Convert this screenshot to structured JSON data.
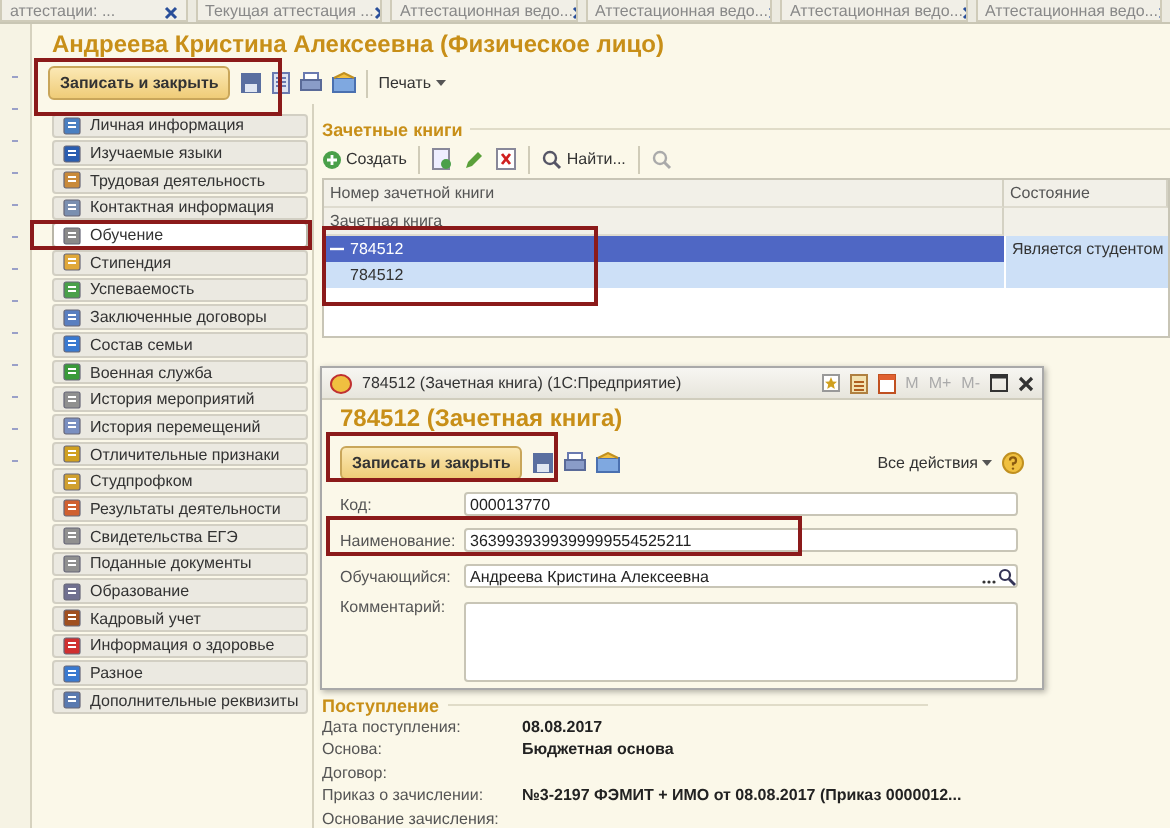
{
  "tabs": [
    {
      "label": "аттестации: ...",
      "selected": false
    },
    {
      "label": "Текущая аттестация ...",
      "selected": false
    },
    {
      "label": "Аттестационная ведо...",
      "selected": false
    },
    {
      "label": "Аттестационная ведо...",
      "selected": false
    },
    {
      "label": "Аттестационная ведо...",
      "selected": false
    },
    {
      "label": "Аттестационная ведо...",
      "selected": false
    }
  ],
  "form": {
    "title": "Андреева Кристина Алексеевна (Физическое лицо)",
    "save_button": "Записать и закрыть",
    "print_button": "Печать"
  },
  "sidebar": {
    "items": [
      {
        "label": "Личная информация",
        "selected": false
      },
      {
        "label": "Изучаемые языки",
        "selected": false
      },
      {
        "label": "Трудовая деятельность",
        "selected": false
      },
      {
        "label": "Контактная информация",
        "selected": false
      },
      {
        "label": "Обучение",
        "selected": true
      },
      {
        "label": "Стипендия",
        "selected": false
      },
      {
        "label": "Успеваемость",
        "selected": false
      },
      {
        "label": "Заключенные договоры",
        "selected": false
      },
      {
        "label": "Состав семьи",
        "selected": false
      },
      {
        "label": "Военная служба",
        "selected": false
      },
      {
        "label": "История мероприятий",
        "selected": false
      },
      {
        "label": "История перемещений",
        "selected": false
      },
      {
        "label": "Отличительные признаки",
        "selected": false
      },
      {
        "label": "Студпрофком",
        "selected": false
      },
      {
        "label": "Результаты деятельности",
        "selected": false
      },
      {
        "label": "Свидетельства ЕГЭ",
        "selected": false
      },
      {
        "label": "Поданные документы",
        "selected": false
      },
      {
        "label": "Образование",
        "selected": false
      },
      {
        "label": "Кадровый учет",
        "selected": false
      },
      {
        "label": "Информация о здоровье",
        "selected": false
      },
      {
        "label": "Разное",
        "selected": false
      },
      {
        "label": "Дополнительные реквизиты",
        "selected": false
      }
    ]
  },
  "record_books": {
    "title": "Зачетные книги",
    "create_button": "Создать",
    "find_button": "Найти...",
    "columns": [
      "Номер зачетной книги",
      "Состояние"
    ],
    "subheader": "Зачетная книга",
    "rows": [
      {
        "number": "784512",
        "status": "Является студентом",
        "selected": true,
        "expanded": true,
        "children": [
          {
            "number": "784512",
            "selected": false
          }
        ]
      }
    ]
  },
  "dialog": {
    "window_title": "784512 (Зачетная книга)  (1С:Предприятие)",
    "memory_buttons": [
      "M",
      "M+",
      "M-"
    ],
    "heading": "784512 (Зачетная книга)",
    "save_button": "Записать и закрыть",
    "all_actions": "Все действия",
    "fields": [
      {
        "label": "Код:",
        "value": "000013770",
        "kind": "text"
      },
      {
        "label": "Наименование:",
        "value": "3639939399399999554525211",
        "kind": "text"
      },
      {
        "label": "Обучающийся:",
        "value": "Андреева Кристина Алексеевна",
        "kind": "select"
      },
      {
        "label": "Комментарий:",
        "kind": "memo"
      }
    ]
  },
  "admission": {
    "title": "Поступление",
    "rows": [
      {
        "label": "Дата поступления:",
        "value": "08.08.2017"
      },
      {
        "label": "Основа:",
        "value": "Бюджетная основа"
      },
      {
        "label": "Договор:"
      },
      {
        "label": "Приказ о зачислении:",
        "value": "№3-2197 ФЭМИТ + ИМО от 08.08.2017 (Приказ 0000012..."
      },
      {
        "label": "Основание зачисления:"
      }
    ]
  }
}
